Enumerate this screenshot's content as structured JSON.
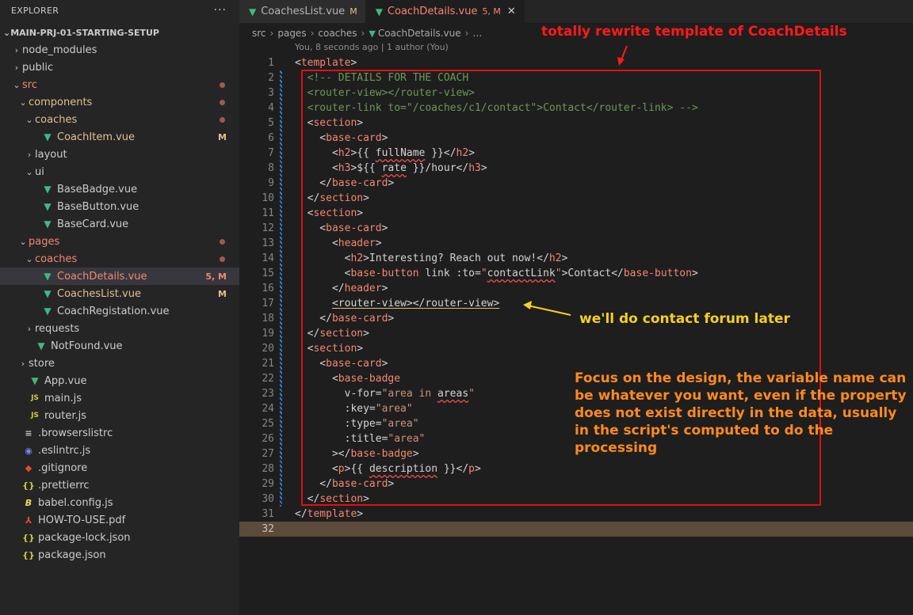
{
  "sidebar": {
    "title": "EXPLORER",
    "more": "···",
    "project": "MAIN-PRJ-01-STARTING-SETUP",
    "items": [
      {
        "label": "node_modules",
        "indent": 0,
        "type": "folder",
        "open": false,
        "status": "normal"
      },
      {
        "label": "public",
        "indent": 0,
        "type": "folder",
        "open": false,
        "status": "normal"
      },
      {
        "label": "src",
        "indent": 0,
        "type": "folder",
        "open": true,
        "status": "error",
        "dot": true
      },
      {
        "label": "components",
        "indent": 1,
        "type": "folder",
        "open": true,
        "status": "modified",
        "dot": true
      },
      {
        "label": "coaches",
        "indent": 2,
        "type": "folder",
        "open": true,
        "status": "modified",
        "dot": true
      },
      {
        "label": "CoachItem.vue",
        "indent": 3,
        "type": "vue",
        "status": "modified",
        "badge": "M"
      },
      {
        "label": "layout",
        "indent": 2,
        "type": "folder",
        "open": false,
        "status": "normal"
      },
      {
        "label": "ui",
        "indent": 2,
        "type": "folder",
        "open": true,
        "status": "normal"
      },
      {
        "label": "BaseBadge.vue",
        "indent": 3,
        "type": "vue",
        "status": "normal"
      },
      {
        "label": "BaseButton.vue",
        "indent": 3,
        "type": "vue",
        "status": "normal"
      },
      {
        "label": "BaseCard.vue",
        "indent": 3,
        "type": "vue",
        "status": "normal"
      },
      {
        "label": "pages",
        "indent": 1,
        "type": "folder",
        "open": true,
        "status": "error",
        "dot": true
      },
      {
        "label": "coaches",
        "indent": 2,
        "type": "folder",
        "open": true,
        "status": "error",
        "dot": true
      },
      {
        "label": "CoachDetails.vue",
        "indent": 3,
        "type": "vue",
        "status": "error",
        "badge": "5, M",
        "active": true
      },
      {
        "label": "CoachesList.vue",
        "indent": 3,
        "type": "vue",
        "status": "modified",
        "badge": "M"
      },
      {
        "label": "CoachRegistation.vue",
        "indent": 3,
        "type": "vue",
        "status": "normal"
      },
      {
        "label": "requests",
        "indent": 2,
        "type": "folder",
        "open": false,
        "status": "normal"
      },
      {
        "label": "NotFound.vue",
        "indent": 2,
        "type": "vue",
        "status": "normal"
      },
      {
        "label": "store",
        "indent": 1,
        "type": "folder",
        "open": false,
        "status": "normal"
      },
      {
        "label": "App.vue",
        "indent": 1,
        "type": "vue",
        "status": "normal"
      },
      {
        "label": "main.js",
        "indent": 1,
        "type": "js",
        "status": "normal"
      },
      {
        "label": "router.js",
        "indent": 1,
        "type": "js",
        "status": "normal"
      },
      {
        "label": ".browserslistrc",
        "indent": 0,
        "type": "browsers",
        "status": "normal"
      },
      {
        "label": ".eslintrc.js",
        "indent": 0,
        "type": "eslint",
        "status": "normal"
      },
      {
        "label": ".gitignore",
        "indent": 0,
        "type": "git",
        "status": "normal"
      },
      {
        "label": ".prettierrc",
        "indent": 0,
        "type": "json",
        "status": "normal"
      },
      {
        "label": "babel.config.js",
        "indent": 0,
        "type": "babel",
        "status": "normal"
      },
      {
        "label": "HOW-TO-USE.pdf",
        "indent": 0,
        "type": "pdf",
        "status": "normal"
      },
      {
        "label": "package-lock.json",
        "indent": 0,
        "type": "json",
        "status": "normal"
      },
      {
        "label": "package.json",
        "indent": 0,
        "type": "json",
        "status": "normal"
      }
    ]
  },
  "tabs": [
    {
      "label": "CoachesList.vue",
      "status": "M",
      "active": false
    },
    {
      "label": "CoachDetails.vue",
      "status": "5, M",
      "active": true,
      "close": "✕"
    }
  ],
  "breadcrumbs": [
    "src",
    "pages",
    "coaches",
    "CoachDetails.vue",
    "…"
  ],
  "blame": "You, 8 seconds ago | 1 author (You)",
  "code_lines": [
    [
      {
        "t": "<",
        "c": "text"
      },
      {
        "t": "template",
        "c": "tag"
      },
      {
        "t": ">",
        "c": "text"
      }
    ],
    [
      {
        "t": "  <!-- DETAILS FOR THE COACH",
        "c": "comment"
      }
    ],
    [
      {
        "t": "  <router-view></router-view>",
        "c": "comment"
      }
    ],
    [
      {
        "t": "  <router-link to=\"/coaches/c1/contact\">Contact</router-link> -->",
        "c": "comment"
      }
    ],
    [
      {
        "t": "  <",
        "c": "text"
      },
      {
        "t": "section",
        "c": "tag"
      },
      {
        "t": ">",
        "c": "text"
      }
    ],
    [
      {
        "t": "    <",
        "c": "text"
      },
      {
        "t": "base-card",
        "c": "tag"
      },
      {
        "t": ">",
        "c": "text"
      }
    ],
    [
      {
        "t": "      <",
        "c": "text"
      },
      {
        "t": "h2",
        "c": "tag"
      },
      {
        "t": ">{{ ",
        "c": "text"
      },
      {
        "t": "fullName",
        "c": "squig"
      },
      {
        "t": " }}</",
        "c": "text"
      },
      {
        "t": "h2",
        "c": "tag"
      },
      {
        "t": ">",
        "c": "text"
      }
    ],
    [
      {
        "t": "      <",
        "c": "text"
      },
      {
        "t": "h3",
        "c": "tag"
      },
      {
        "t": ">${{ ",
        "c": "text"
      },
      {
        "t": "rate",
        "c": "squig"
      },
      {
        "t": " }}/hour</",
        "c": "text"
      },
      {
        "t": "h3",
        "c": "tag"
      },
      {
        "t": ">",
        "c": "text"
      }
    ],
    [
      {
        "t": "    </",
        "c": "text"
      },
      {
        "t": "base-card",
        "c": "tag"
      },
      {
        "t": ">",
        "c": "text"
      }
    ],
    [
      {
        "t": "  </",
        "c": "text"
      },
      {
        "t": "section",
        "c": "tag"
      },
      {
        "t": ">",
        "c": "text"
      }
    ],
    [
      {
        "t": "  <",
        "c": "text"
      },
      {
        "t": "section",
        "c": "tag"
      },
      {
        "t": ">",
        "c": "text"
      }
    ],
    [
      {
        "t": "    <",
        "c": "text"
      },
      {
        "t": "base-card",
        "c": "tag"
      },
      {
        "t": ">",
        "c": "text"
      }
    ],
    [
      {
        "t": "      <",
        "c": "text"
      },
      {
        "t": "header",
        "c": "tag"
      },
      {
        "t": ">",
        "c": "text"
      }
    ],
    [
      {
        "t": "        <",
        "c": "text"
      },
      {
        "t": "h2",
        "c": "tag"
      },
      {
        "t": ">Interesting? Reach out now!</",
        "c": "text"
      },
      {
        "t": "h2",
        "c": "tag"
      },
      {
        "t": ">",
        "c": "text"
      }
    ],
    [
      {
        "t": "        <",
        "c": "text"
      },
      {
        "t": "base-button",
        "c": "tag"
      },
      {
        "t": " link :to=",
        "c": "attr"
      },
      {
        "t": "\"",
        "c": "str"
      },
      {
        "t": "contactLink",
        "c": "squig"
      },
      {
        "t": "\"",
        "c": "str"
      },
      {
        "t": ">Contact</",
        "c": "text"
      },
      {
        "t": "base-button",
        "c": "tag"
      },
      {
        "t": ">",
        "c": "text"
      }
    ],
    [
      {
        "t": "      </",
        "c": "text"
      },
      {
        "t": "header",
        "c": "tag"
      },
      {
        "t": ">",
        "c": "text"
      }
    ],
    [
      {
        "t": "      ",
        "c": "text"
      },
      {
        "t": "<router-view></router-view>",
        "c": "under"
      }
    ],
    [
      {
        "t": "    </",
        "c": "text"
      },
      {
        "t": "base-card",
        "c": "tag"
      },
      {
        "t": ">",
        "c": "text"
      }
    ],
    [
      {
        "t": "  </",
        "c": "text"
      },
      {
        "t": "section",
        "c": "tag"
      },
      {
        "t": ">",
        "c": "text"
      }
    ],
    [
      {
        "t": "  <",
        "c": "text"
      },
      {
        "t": "section",
        "c": "tag"
      },
      {
        "t": ">",
        "c": "text"
      }
    ],
    [
      {
        "t": "    <",
        "c": "text"
      },
      {
        "t": "base-card",
        "c": "tag"
      },
      {
        "t": ">",
        "c": "text"
      }
    ],
    [
      {
        "t": "      <",
        "c": "text"
      },
      {
        "t": "base-badge",
        "c": "tag"
      }
    ],
    [
      {
        "t": "        v-for=",
        "c": "attr"
      },
      {
        "t": "\"area in ",
        "c": "str"
      },
      {
        "t": "areas",
        "c": "squig"
      },
      {
        "t": "\"",
        "c": "str"
      }
    ],
    [
      {
        "t": "        :key=",
        "c": "attr"
      },
      {
        "t": "\"area\"",
        "c": "str"
      }
    ],
    [
      {
        "t": "        :type=",
        "c": "attr"
      },
      {
        "t": "\"area\"",
        "c": "str"
      }
    ],
    [
      {
        "t": "        :title=",
        "c": "attr"
      },
      {
        "t": "\"area\"",
        "c": "str"
      }
    ],
    [
      {
        "t": "      ></",
        "c": "text"
      },
      {
        "t": "base-badge",
        "c": "tag"
      },
      {
        "t": ">",
        "c": "text"
      }
    ],
    [
      {
        "t": "      <",
        "c": "text"
      },
      {
        "t": "p",
        "c": "tag"
      },
      {
        "t": ">{{ ",
        "c": "text"
      },
      {
        "t": "description",
        "c": "squig"
      },
      {
        "t": " }}</",
        "c": "text"
      },
      {
        "t": "p",
        "c": "tag"
      },
      {
        "t": ">",
        "c": "text"
      }
    ],
    [
      {
        "t": "    </",
        "c": "text"
      },
      {
        "t": "base-card",
        "c": "tag"
      },
      {
        "t": ">",
        "c": "text"
      }
    ],
    [
      {
        "t": "  </",
        "c": "text"
      },
      {
        "t": "section",
        "c": "tag"
      },
      {
        "t": ">",
        "c": "text"
      }
    ],
    [
      {
        "t": "</",
        "c": "text"
      },
      {
        "t": "template",
        "c": "tag"
      },
      {
        "t": ">",
        "c": "text"
      }
    ],
    []
  ],
  "annotations": {
    "title": "totally rewrite template of CoachDetails",
    "contact_note": "we'll do contact forum later",
    "focus_note": "Focus on the design, the variable name can be whatever you want, even if the property does not exist directly in the data, usually in the script's computed to do the processing"
  },
  "colors": {
    "annotation_red": "#ff1a1a",
    "annotation_yellow": "#f5d020",
    "annotation_orange": "#ff8a1e",
    "vue_green": "#41b883"
  }
}
